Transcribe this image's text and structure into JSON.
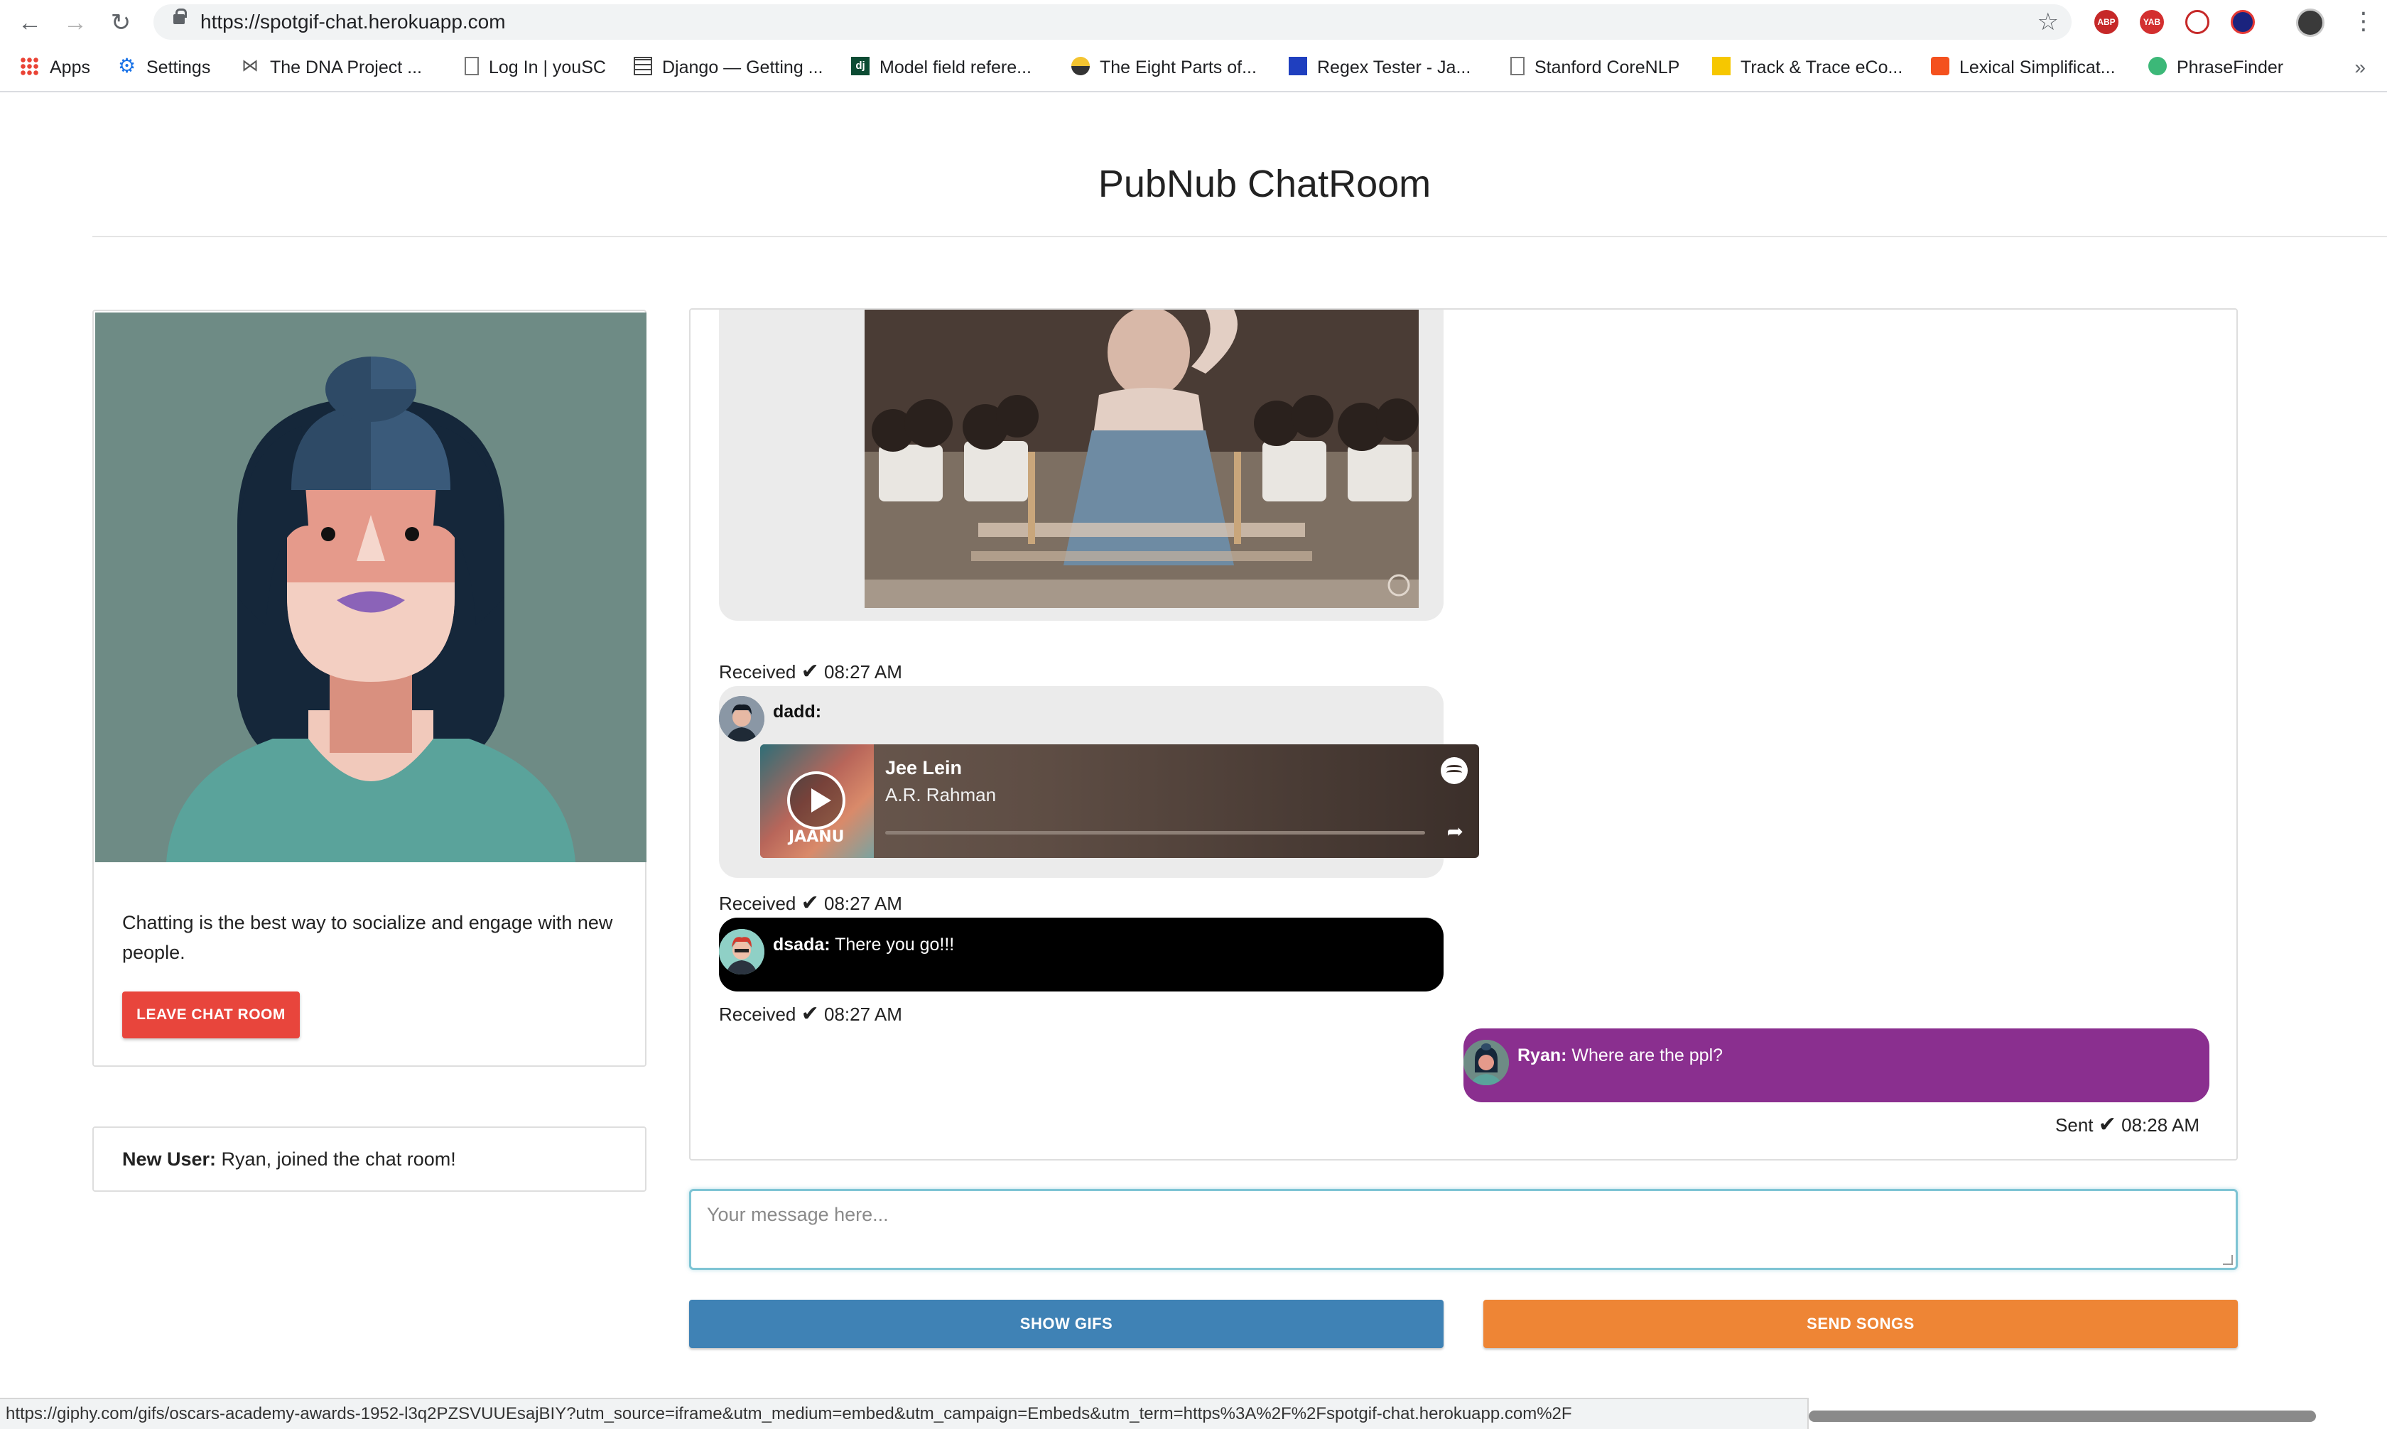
{
  "browser": {
    "url": "https://spotgif-chat.herokuapp.com",
    "bookmarks": [
      {
        "label": "Apps",
        "icon": "apps-grid-icon"
      },
      {
        "label": "Settings",
        "icon": "gear-icon"
      },
      {
        "label": "The DNA Project ...",
        "icon": "dna-icon"
      },
      {
        "label": "Log In | youSC",
        "icon": "page-icon"
      },
      {
        "label": "Django — Getting ...",
        "icon": "django-icon"
      },
      {
        "label": "Model field refere...",
        "icon": "dj-icon"
      },
      {
        "label": "The Eight Parts of...",
        "icon": "globe-icon"
      },
      {
        "label": "Regex Tester - Ja...",
        "icon": "regex-icon"
      },
      {
        "label": "Stanford CoreNLP",
        "icon": "page-icon"
      },
      {
        "label": "Track & Trace eCo...",
        "icon": "track-icon"
      },
      {
        "label": "Lexical Simplificat...",
        "icon": "blogger-icon"
      },
      {
        "label": "PhraseFinder",
        "icon": "phrasefinder-icon"
      }
    ],
    "extensions": [
      "ABP",
      "YAB"
    ],
    "status_url": "https://giphy.com/gifs/oscars-academy-awards-1952-l3q2PZSVUUEsajBIY?utm_source=iframe&utm_medium=embed&utm_campaign=Embeds&utm_term=https%3A%2F%2Fspotgif-chat.herokuapp.com%2F"
  },
  "page": {
    "title": "PubNub ChatRoom"
  },
  "sidebar": {
    "description": "Chatting is the best way to socialize and engage with new people.",
    "leave_button": "LEAVE CHAT ROOM",
    "notice_label": "New User:",
    "notice_text": " Ryan, joined the chat room!"
  },
  "messages": [
    {
      "kind": "gif",
      "status": "Received",
      "time": "08:27 AM"
    },
    {
      "kind": "song",
      "sender": "dadd:",
      "song_title": "Jee Lein",
      "artist": "A.R. Rahman",
      "album_label": "JAANU",
      "status": "Received",
      "time": "08:27 AM"
    },
    {
      "kind": "text",
      "sender": "dsada:",
      "text": "There you go!!!",
      "status": "Received",
      "time": "08:27 AM"
    },
    {
      "kind": "text",
      "sender": "Ryan:",
      "text": "Where are the ppl?",
      "status": "Sent",
      "time": "08:28 AM"
    }
  ],
  "composer": {
    "placeholder": "Your message here..."
  },
  "actions": {
    "show_gifs": "SHOW GIFS",
    "send_songs": "SEND SONGS"
  },
  "colors": {
    "leave": "#e8453c",
    "gifs": "#3f82b5",
    "songs": "#ee8535",
    "sent_bubble": "#8a2f8f",
    "received_dark": "#000000",
    "received_grey": "#ebebeb"
  }
}
